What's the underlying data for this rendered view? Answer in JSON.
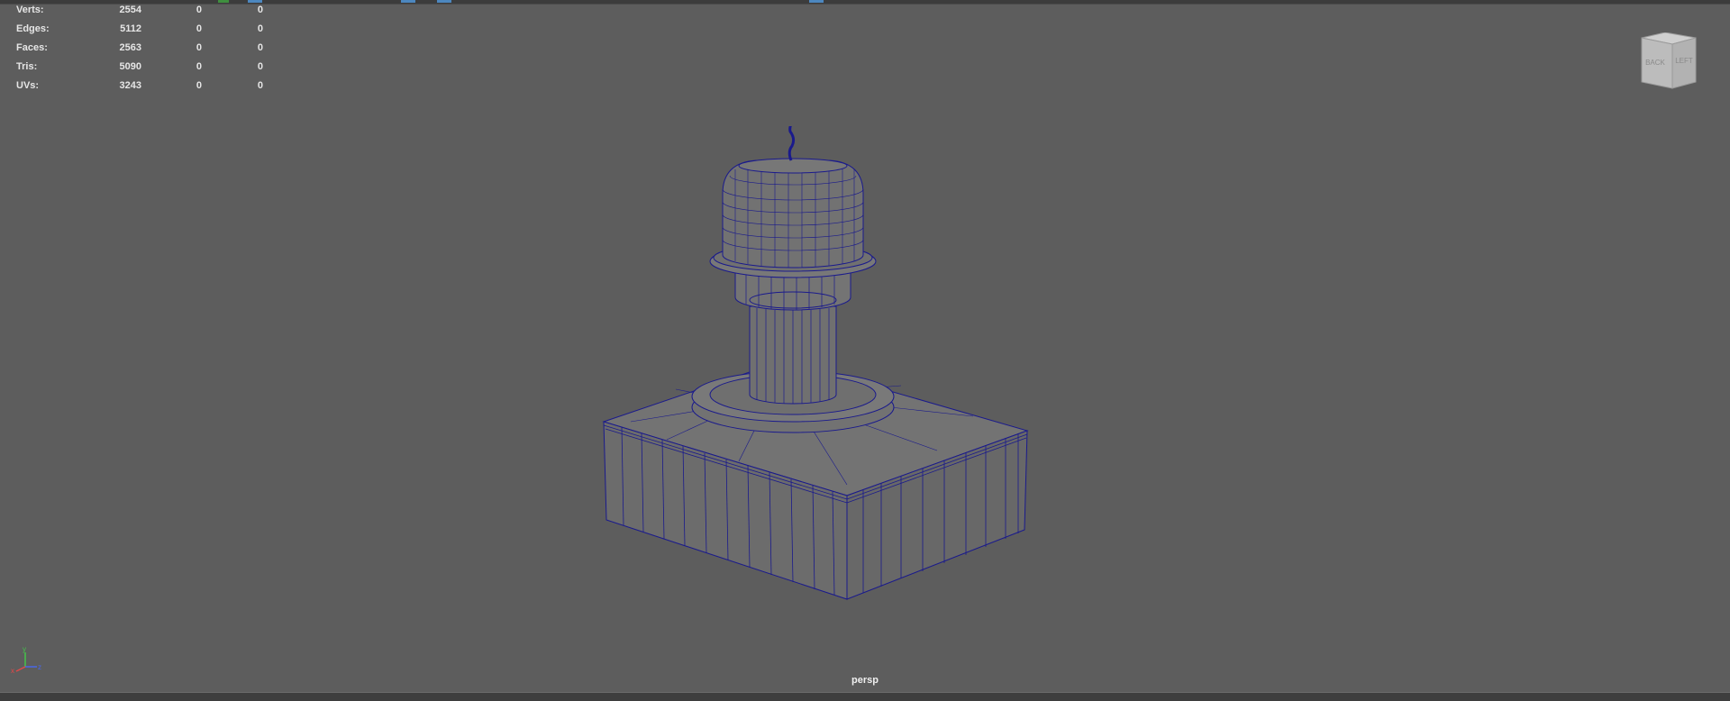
{
  "hud": {
    "rows": [
      {
        "label": "Verts:",
        "values": [
          "2554",
          "0",
          "0"
        ]
      },
      {
        "label": "Edges:",
        "values": [
          "5112",
          "0",
          "0"
        ]
      },
      {
        "label": "Faces:",
        "values": [
          "2563",
          "0",
          "0"
        ]
      },
      {
        "label": "Tris:",
        "values": [
          "5090",
          "0",
          "0"
        ]
      },
      {
        "label": "UVs:",
        "values": [
          "3243",
          "0",
          "0"
        ]
      }
    ]
  },
  "viewport": {
    "camera_label": "persp",
    "background_color": "#5d5d5d",
    "wire_color": "#1a1a8c"
  },
  "view_cube": {
    "face_back": "BACK",
    "face_left": "LEFT"
  },
  "axis_gizmo": {
    "x": "x",
    "y": "y",
    "z": "z"
  }
}
